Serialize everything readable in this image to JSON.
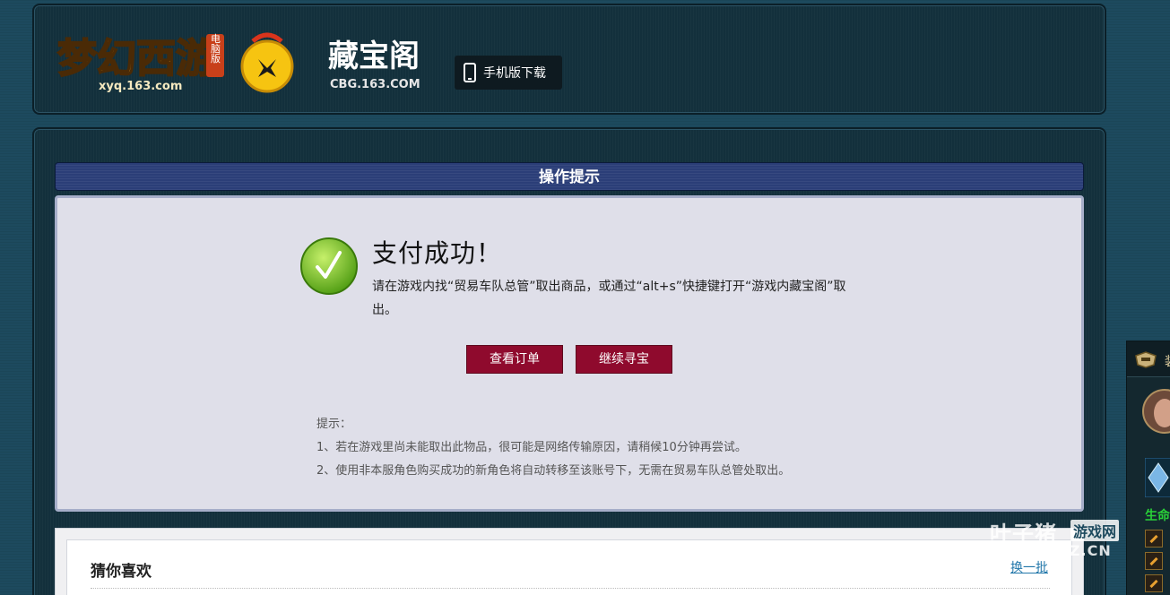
{
  "header": {
    "xyq_logo": {
      "title": "梦幻西游",
      "domain": "xyq.163.com",
      "badge": "电脑版"
    },
    "cbg_logo": {
      "title": "藏宝阁",
      "domain": "CBG.163.COM"
    },
    "mobile_download_label": "手机版下载"
  },
  "operation": {
    "title": "操作提示",
    "success_title": "支付成功！",
    "success_desc": "请在游戏内找“贸易车队总管”取出商品，或通过“alt+s”快捷键打开“游戏内藏宝阁”取出。",
    "buttons": {
      "view_order": "查看订单",
      "continue": "继续寻宝"
    },
    "tips_title": "提示：",
    "tips": [
      "1、若在游戏里尚未能取出此物品，很可能是网络传输原因，请稍候10分钟再尝试。",
      "2、使用非本服角色购买成功的新角色将自动转移至该账号下，无需在贸易车队总管处取出。"
    ]
  },
  "guess": {
    "title": "猜你喜欢",
    "refresh_label": "换一批"
  },
  "side_panel": {
    "head_label": "装",
    "green_label": "生命"
  },
  "watermark": {
    "main": "叶子猪",
    "tag": "游戏网",
    "url": "WWW.YZZ.CN"
  },
  "colors": {
    "button_bg": "#8f0a2d",
    "title_bar": "#2b3e78",
    "success_green": "#6fc21a"
  }
}
